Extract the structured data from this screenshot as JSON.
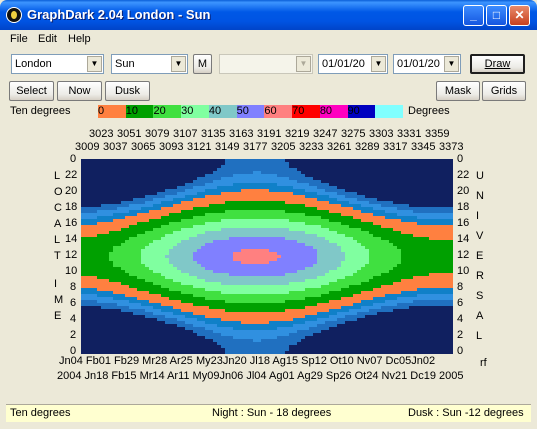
{
  "window": {
    "title": "GraphDark 2.04  London  -  Sun",
    "minimize": "_",
    "maximize": "□",
    "close": "✕"
  },
  "menu": [
    "File",
    "Edit",
    "Help"
  ],
  "toolbar": {
    "location": "London",
    "body": "Sun",
    "m_label": "M",
    "blank_combo": "",
    "date_from": "01/01/20",
    "date_to": "01/01/20",
    "draw_label": "Draw"
  },
  "toolbar2": {
    "select": "Select",
    "now": "Now",
    "dusk": "Dusk",
    "mask": "Mask",
    "grids": "Grids"
  },
  "legend": {
    "left_label": "Ten degrees",
    "right_label": "Degrees",
    "labels": [
      "0",
      "10",
      "20",
      "30",
      "40",
      "50",
      "60",
      "70",
      "80",
      "90"
    ],
    "colors": [
      "#FF8040",
      "#00A000",
      "#40E040",
      "#80FFA0",
      "#80C8C8",
      "#8080FF",
      "#FF8080",
      "#FF0000",
      "#FF00C0",
      "#0000C0",
      "#80FFFF"
    ]
  },
  "chart_data": {
    "type": "heatmap",
    "description_axis_top_row1": [
      "3023",
      "3051",
      "3079",
      "3107",
      "3135",
      "3163",
      "3191",
      "3219",
      "3247",
      "3275",
      "3303",
      "3331",
      "3359"
    ],
    "description_axis_top_row2": [
      "3009",
      "3037",
      "3065",
      "3093",
      "3121",
      "3149",
      "3177",
      "3205",
      "3233",
      "3261",
      "3289",
      "3317",
      "3345",
      "3373"
    ],
    "y_left_ticks": [
      "0",
      "22",
      "20",
      "18",
      "16",
      "14",
      "12",
      "10",
      "8",
      "6",
      "4",
      "2",
      "0"
    ],
    "y_right_ticks": [
      "0",
      "22",
      "20",
      "18",
      "16",
      "14",
      "12",
      "10",
      "8",
      "6",
      "4",
      "2",
      "0"
    ],
    "y_left_label": "LOCAL TIME",
    "y_right_label": "UNIVERSAL",
    "x_bottom_row1": "Jn04 Fb01 Fb29 Mr28 Ar25  My23Jn20 Jl18  Ag15 Sp12 Ot10  Nv07 Dc05Jn02",
    "x_bottom_row2": "2004  Jn18 Fb15 Mr14 Ar11  My09Jn06 Jl04  Ag01 Ag29 Sp26 Ot24  Nv21 Dc19  2005",
    "x_corner": "rf",
    "ylim": [
      0,
      24
    ],
    "bands_altitude_degrees": [
      -18,
      -12,
      -6,
      0,
      10,
      20,
      30,
      40,
      50,
      60
    ]
  },
  "status": {
    "left": "Ten degrees",
    "middle": "Night : Sun - 18 degrees",
    "right": "Dusk : Sun -12 degrees"
  }
}
